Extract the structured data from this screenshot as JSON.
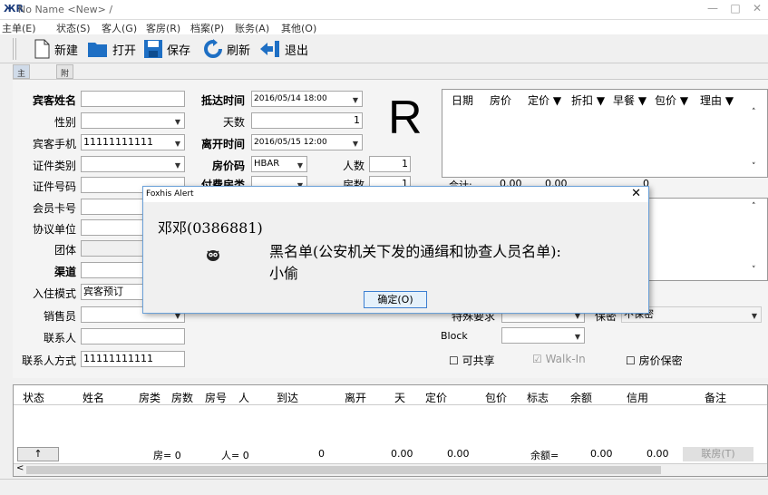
{
  "window": {
    "title": "No Name <New> /",
    "min": "—",
    "max": "□",
    "close": "✕"
  },
  "menu": [
    "主单(E)",
    "状态(S)",
    "客人(G)",
    "客房(R)",
    "档案(P)",
    "账务(A)",
    "其他(O)"
  ],
  "toolbar": {
    "new": "新建",
    "open": "打开",
    "save": "保存",
    "refresh": "刷新",
    "exit": "退出"
  },
  "tabs": [
    "主要信息",
    "附加信息"
  ],
  "form": {
    "guest_name_label": "宾客姓名",
    "gender_label": "性别",
    "mobile_label": "宾客手机",
    "mobile_value": "11111111111",
    "id_type_label": "证件类别",
    "id_no_label": "证件号码",
    "member_label": "会员卡号",
    "agreement_label": "协议单位",
    "group_label": "团体",
    "channel_label": "渠道",
    "checkin_mode_label": "入住模式",
    "checkin_mode_value": "宾客预订",
    "sales_label": "销售员",
    "contact_label": "联系人",
    "contact_method_label": "联系人方式",
    "contact_method_value": "11111111111",
    "arrive_label": "抵达时间",
    "arrive_value": "2016/05/14 18:00",
    "days_label": "天数",
    "days_value": "1",
    "depart_label": "离开时间",
    "depart_value": "2016/05/15 12:00",
    "rate_code_label": "房价码",
    "rate_code_value": "HBAR",
    "persons_label": "人数",
    "persons_value": "1",
    "pay_type_label": "付费房类",
    "room_count_label": "房数",
    "room_count_value": "1",
    "room_type_letter": "R"
  },
  "rate_grid": {
    "headers": [
      "日期",
      "房价",
      "定价 ▼",
      "折扣 ▼",
      "早餐 ▼",
      "包价 ▼",
      "理由 ▼"
    ],
    "total_label": "合计:",
    "total_price": "0.00",
    "total_rate": "0.00",
    "total_disc": "0"
  },
  "right_fields": {
    "special_req_label": "特殊要求",
    "secret_label": "保密",
    "secret_value": "不保密",
    "block_label": "Block",
    "shareable": "可共享",
    "walkin": "Walk-In",
    "rate_secret": "房价保密"
  },
  "bottom_grid": {
    "headers": [
      "状态",
      "姓名",
      "房类",
      "房数",
      "房号",
      "人",
      "到达",
      "离开",
      "天",
      "定价",
      "包价",
      "标志",
      "余额",
      "信用",
      "备注"
    ],
    "totals": {
      "rooms": "房= 0",
      "persons": "人= 0",
      "arrive": "0",
      "rate": "0.00",
      "pkg": "0.00",
      "balance_label": "余额=",
      "balance": "0.00",
      "credit": "0.00",
      "link_btn": "联房(T)"
    }
  },
  "dialog": {
    "title": "Foxhis Alert",
    "close": "✕",
    "name": "邓邓(0386881)",
    "message_line1": "黑名单(公安机关下发的通缉和协查人员名单):",
    "message_line2": "小偷",
    "ok": "确定(O)"
  }
}
